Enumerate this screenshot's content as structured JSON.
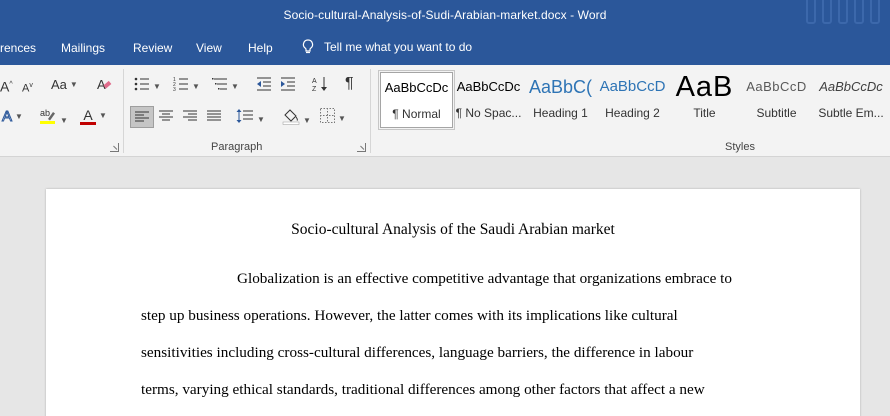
{
  "window": {
    "title": "Socio-cultural-Analysis-of-Sudi-Arabian-market.docx  -  Word"
  },
  "tabs": {
    "references": "rences",
    "mailings": "Mailings",
    "review": "Review",
    "view": "View",
    "help": "Help",
    "tell_me": "Tell me what you want to do"
  },
  "ribbon": {
    "font_group": {
      "grow_font": "A",
      "shrink_font": "A",
      "change_case": "Aa",
      "text_effects": "A",
      "font_color": "A"
    },
    "paragraph_group": {
      "label": "Paragraph",
      "show_marks": "¶"
    },
    "styles_group": {
      "label": "Styles",
      "items": [
        {
          "preview": "AaBbCcDc",
          "name": "¶ Normal"
        },
        {
          "preview": "AaBbCcDc",
          "name": "¶ No Spac..."
        },
        {
          "preview": "AaBbC(",
          "name": "Heading 1"
        },
        {
          "preview": "AaBbCcD",
          "name": "Heading 2"
        },
        {
          "preview": "AaB",
          "name": "Title"
        },
        {
          "preview": "AaBbCcD",
          "name": "Subtitle"
        },
        {
          "preview": "AaBbCcDc",
          "name": "Subtle Em..."
        }
      ]
    }
  },
  "colors": {
    "word_blue": "#2b579a",
    "heading_blue": "#2e74b5",
    "font_color_red": "#c00000",
    "highlight_yellow": "#ffff00"
  },
  "document": {
    "title": "Socio-cultural Analysis of the Saudi Arabian market",
    "paragraph_lines": [
      "Globalization is an effective competitive advantage that organizations embrace to",
      "step up business operations. However, the latter comes with its implications like cultural",
      "sensitivities including cross-cultural differences, language barriers, the difference in labour",
      "terms, varying ethical standards, traditional differences among other factors that affect a new"
    ]
  }
}
